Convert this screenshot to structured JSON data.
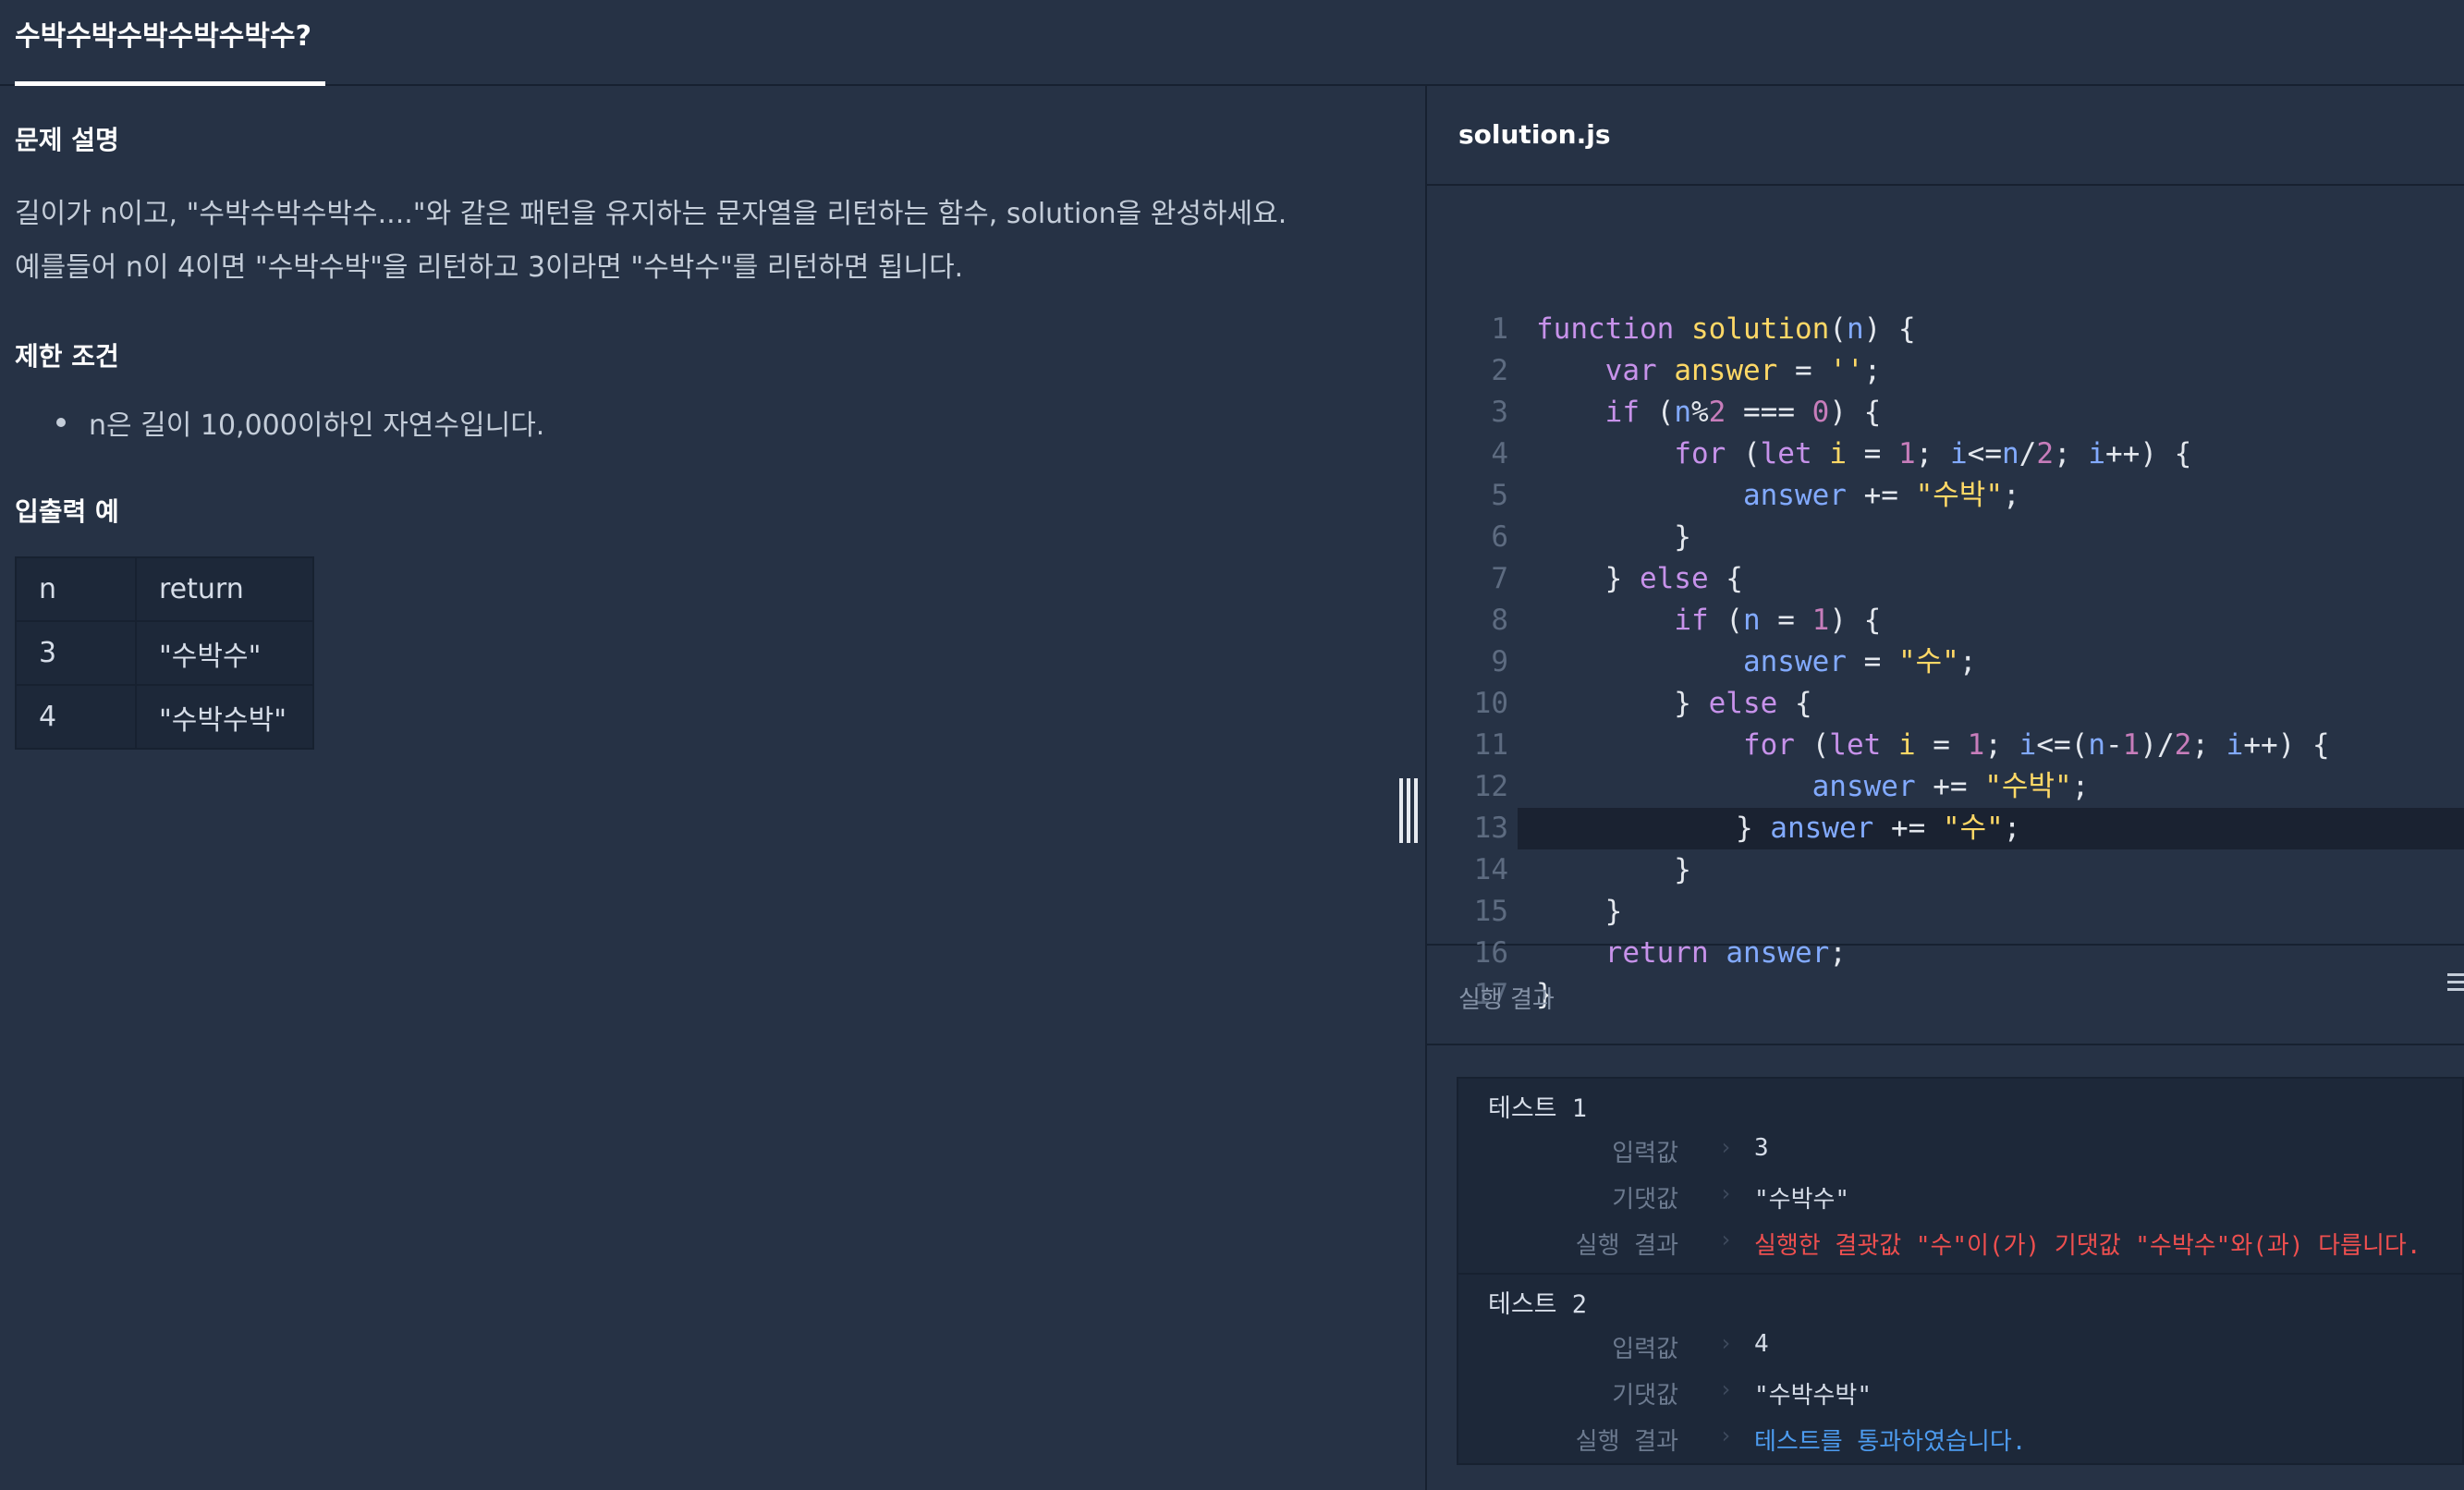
{
  "tab": {
    "title": "수박수박수박수박수박수?"
  },
  "problem": {
    "description_title": "문제 설명",
    "description_lines": [
      "길이가 n이고, \"수박수박수박수....\"와 같은 패턴을 유지하는 문자열을 리턴하는 함수, solution을 완성하세요.",
      "예를들어 n이 4이면 \"수박수박\"을 리턴하고 3이라면 \"수박수\"를 리턴하면 됩니다."
    ],
    "constraints_title": "제한 조건",
    "constraints": [
      "n은 길이 10,000이하인 자연수입니다."
    ],
    "examples_title": "입출력 예",
    "table": {
      "headers": [
        "n",
        "return"
      ],
      "rows": [
        [
          "3",
          "\"수박수\""
        ],
        [
          "4",
          "\"수박수박\""
        ]
      ]
    }
  },
  "editor": {
    "file_name": "solution.js",
    "line_numbers": [
      "1",
      "2",
      "3",
      "4",
      "5",
      "6",
      "7",
      "8",
      "9",
      "10",
      "11",
      "12",
      "13",
      "14",
      "15",
      "16",
      "17"
    ],
    "active_line": 13
  },
  "results": {
    "title": "실행 결과",
    "input_label": "입력값",
    "expected_label": "기댓값",
    "result_label": "실행 결과",
    "tests": [
      {
        "name": "테스트 1",
        "input": "3",
        "expected": "\"수박수\"",
        "result": "실행한 결괏값 \"수\"이(가) 기댓값 \"수박수\"와(과) 다릅니다.",
        "status": "fail"
      },
      {
        "name": "테스트 2",
        "input": "4",
        "expected": "\"수박수박\"",
        "result": "테스트를 통과하였습니다.",
        "status": "pass"
      }
    ]
  },
  "colors": {
    "background": "#263245",
    "fail": "#ef4f4f",
    "pass": "#4d9cf0",
    "keyword": "#c792ea",
    "string": "#ffd866",
    "variable": "#82aaff"
  }
}
